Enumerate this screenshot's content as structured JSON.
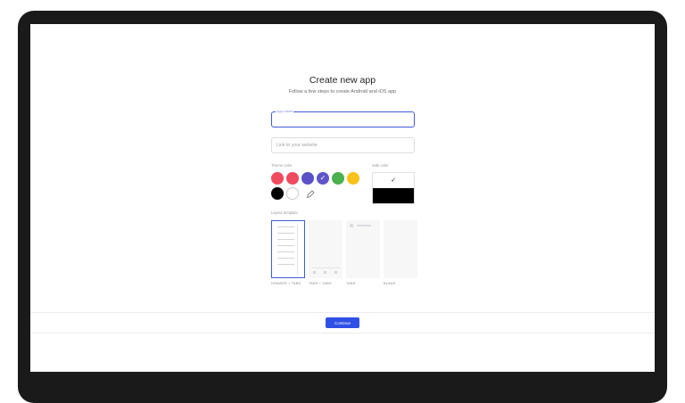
{
  "header": {
    "title": "Create new app",
    "subtitle": "Follow a few steps to create Android and iOS app"
  },
  "form": {
    "app_name_label": "App name",
    "app_name_value": "",
    "website_placeholder": "Link to your website",
    "website_value": ""
  },
  "theme": {
    "label": "Theme color",
    "swatches": [
      {
        "name": "red",
        "color": "#f04a5f",
        "selected": false
      },
      {
        "name": "crimson",
        "color": "#ef4b5f",
        "selected": false
      },
      {
        "name": "indigo",
        "color": "#5a51c8",
        "selected": false
      },
      {
        "name": "violet",
        "color": "#5f55c9",
        "selected": true
      },
      {
        "name": "green",
        "color": "#4caf50",
        "selected": false
      },
      {
        "name": "amber",
        "color": "#f8c21b",
        "selected": false
      },
      {
        "name": "black",
        "color": "#000000",
        "selected": false
      },
      {
        "name": "white",
        "color": "#ffffff",
        "selected": false
      }
    ]
  },
  "side_color": {
    "label": "Side color",
    "top_color": "#ffffff",
    "bottom_color": "#000000"
  },
  "layout": {
    "label": "Layout template",
    "templates": [
      {
        "id": "drawer-tabs",
        "caption": "DRAWER + TABS",
        "selected": true
      },
      {
        "id": "tabs-tabs",
        "caption": "TABS + TABS",
        "selected": false
      },
      {
        "id": "tabs",
        "caption": "TABS",
        "selected": false
      },
      {
        "id": "blank",
        "caption": "BLANK",
        "selected": false
      }
    ]
  },
  "footer": {
    "continue_label": "Continue"
  },
  "colors": {
    "accent": "#2f50e6",
    "focus_border": "#3f5bd9"
  }
}
